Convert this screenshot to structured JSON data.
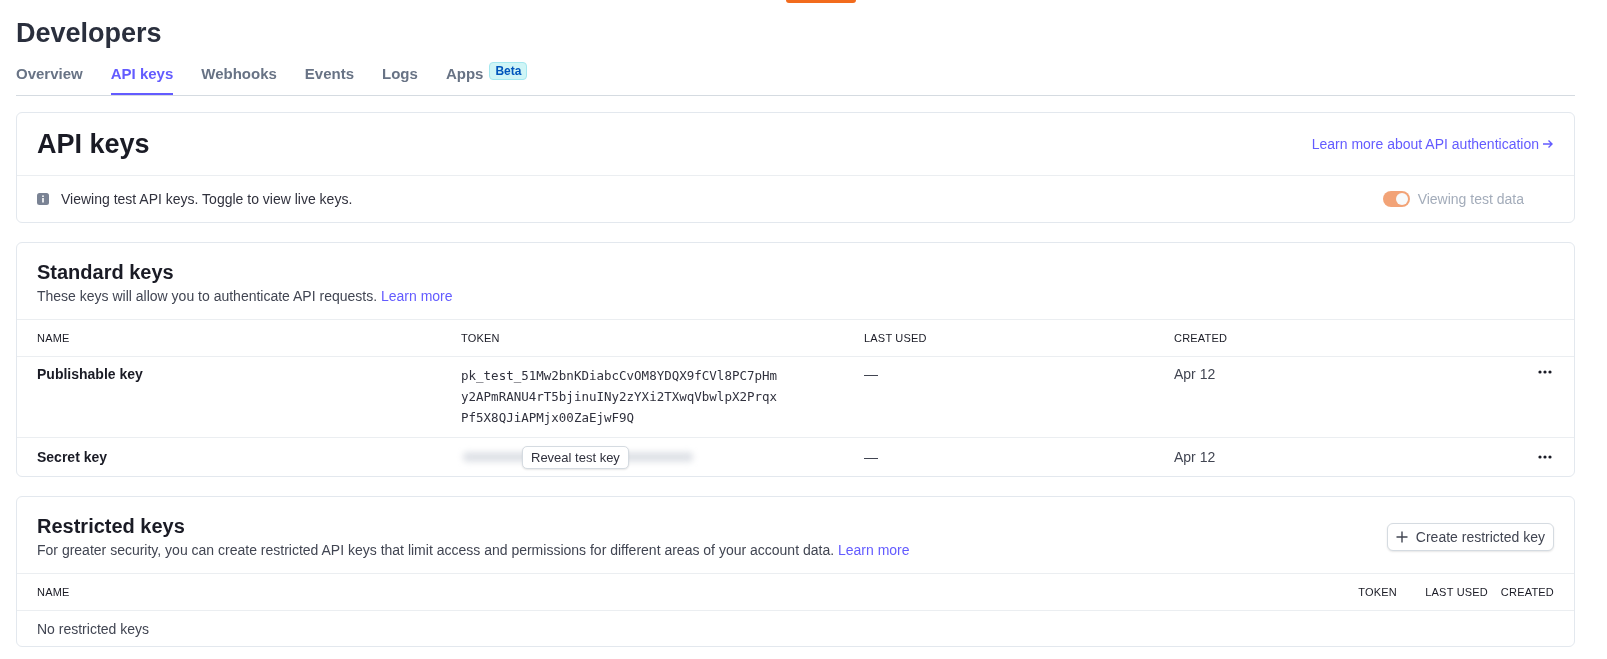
{
  "page_title": "Developers",
  "tabs": [
    {
      "label": "Overview",
      "selected": false
    },
    {
      "label": "API keys",
      "selected": true
    },
    {
      "label": "Webhooks",
      "selected": false
    },
    {
      "label": "Events",
      "selected": false
    },
    {
      "label": "Logs",
      "selected": false
    },
    {
      "label": "Apps",
      "selected": false,
      "badge": "Beta"
    }
  ],
  "api_keys_card": {
    "title": "API keys",
    "link": "Learn more about API authentication",
    "notice": "Viewing test API keys. Toggle to view live keys.",
    "toggle": {
      "label": "Viewing test data",
      "on": true
    }
  },
  "standard_keys": {
    "title": "Standard keys",
    "description": "These keys will allow you to authenticate API requests.",
    "link": "Learn more",
    "columns": [
      "NAME",
      "TOKEN",
      "LAST USED",
      "CREATED"
    ],
    "rows": [
      {
        "kind": "visible",
        "name": "Publishable key",
        "token_lines": [
          "pk_test_51Mw2bnKDiabcCvOM8YDQX9fCVl8PC7pHm",
          "y2APmRANU4rT5bjinuINy2zYXi2TXwqVbwlpX2Prqx",
          "Pf5X8QJiAPMjx00ZaEjwF9Q"
        ],
        "last_used": "—",
        "created": "Apr 12"
      },
      {
        "kind": "hidden",
        "name": "Secret key",
        "reveal_button": "Reveal test key",
        "last_used": "—",
        "created": "Apr 12"
      }
    ]
  },
  "restricted_keys": {
    "title": "Restricted keys",
    "description": "For greater security, you can create restricted API keys that limit access and permissions for different areas of your account data.",
    "link": "Learn more",
    "button": "Create restricted key",
    "columns": [
      "NAME",
      "TOKEN",
      "LAST USED",
      "CREATED"
    ],
    "empty_text": "No restricted keys"
  }
}
